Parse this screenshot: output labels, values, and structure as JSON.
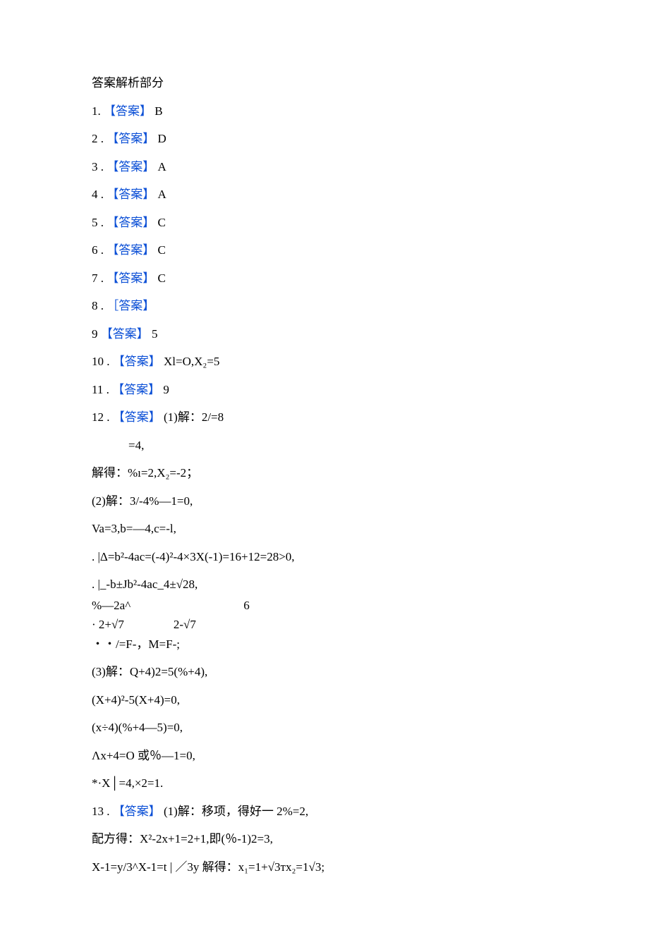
{
  "section_title": "答案解析部分",
  "label_answer": "【答案】",
  "label_answer_alt": "［答案】",
  "items": {
    "q1": {
      "num": "1.",
      "val": "B"
    },
    "q2": {
      "num": "2  .",
      "val": "D"
    },
    "q3": {
      "num": "3  .",
      "val": "A"
    },
    "q4": {
      "num": "4  .",
      "val": "A"
    },
    "q5": {
      "num": "5  .",
      "val": "C"
    },
    "q6": {
      "num": "6  .",
      "val": "C"
    },
    "q7": {
      "num": "7  .",
      "val": "C"
    },
    "q8": {
      "num": "8  .",
      "val": ""
    },
    "q9": {
      "num": "9",
      "val": "5"
    },
    "q10": {
      "num": "10  .",
      "val": "Xl=O,X₂=5"
    },
    "q11": {
      "num": "11  .",
      "val": "9"
    },
    "q12": {
      "num": "12  .",
      "p1_head": "(1)解：2/=8",
      "p1_l2": "=4,",
      "p1_l3": "解得：%ı=2,X₂=-2；",
      "p2_l1": "(2)解：3/-4%—1=0,",
      "p2_l2": "Va=3,b=—4,c=-l,",
      "p2_l3": ". |Δ=b²-4ac=(-4)²-4×3X(-1)=16+12=28>0,",
      "p2_frac_top": ". |_-b±Jb²-4ac_4±√28,",
      "p2_frac_bot_left": "   %—2a^",
      "p2_frac_bot_right": "6",
      "p2_row_a": "·        2+√7",
      "p2_row_b": "2-√7",
      "p2_l6": "・・/=F-，M=F-;",
      "p3_l1": "(3)解：Q+4)2=5(%+4),",
      "p3_l2": "(X+4)²-5(X+4)=0,",
      "p3_l3": "(x÷4)(%+4—5)=0,",
      "p3_l4": "Λx+4=O 或％—1=0,",
      "p3_l5": "*·X│=4,×2=1."
    },
    "q13": {
      "num": "13  .",
      "l1": "(1)解：移项，得好一 2%=2,",
      "l2": "配方得：X²-2x+1=2+1,即(％-1)2=3,",
      "l3": "X-1=y/3^X-1=t | ／3y 解得：x₁=1+√3тx₂=1√3;"
    }
  }
}
